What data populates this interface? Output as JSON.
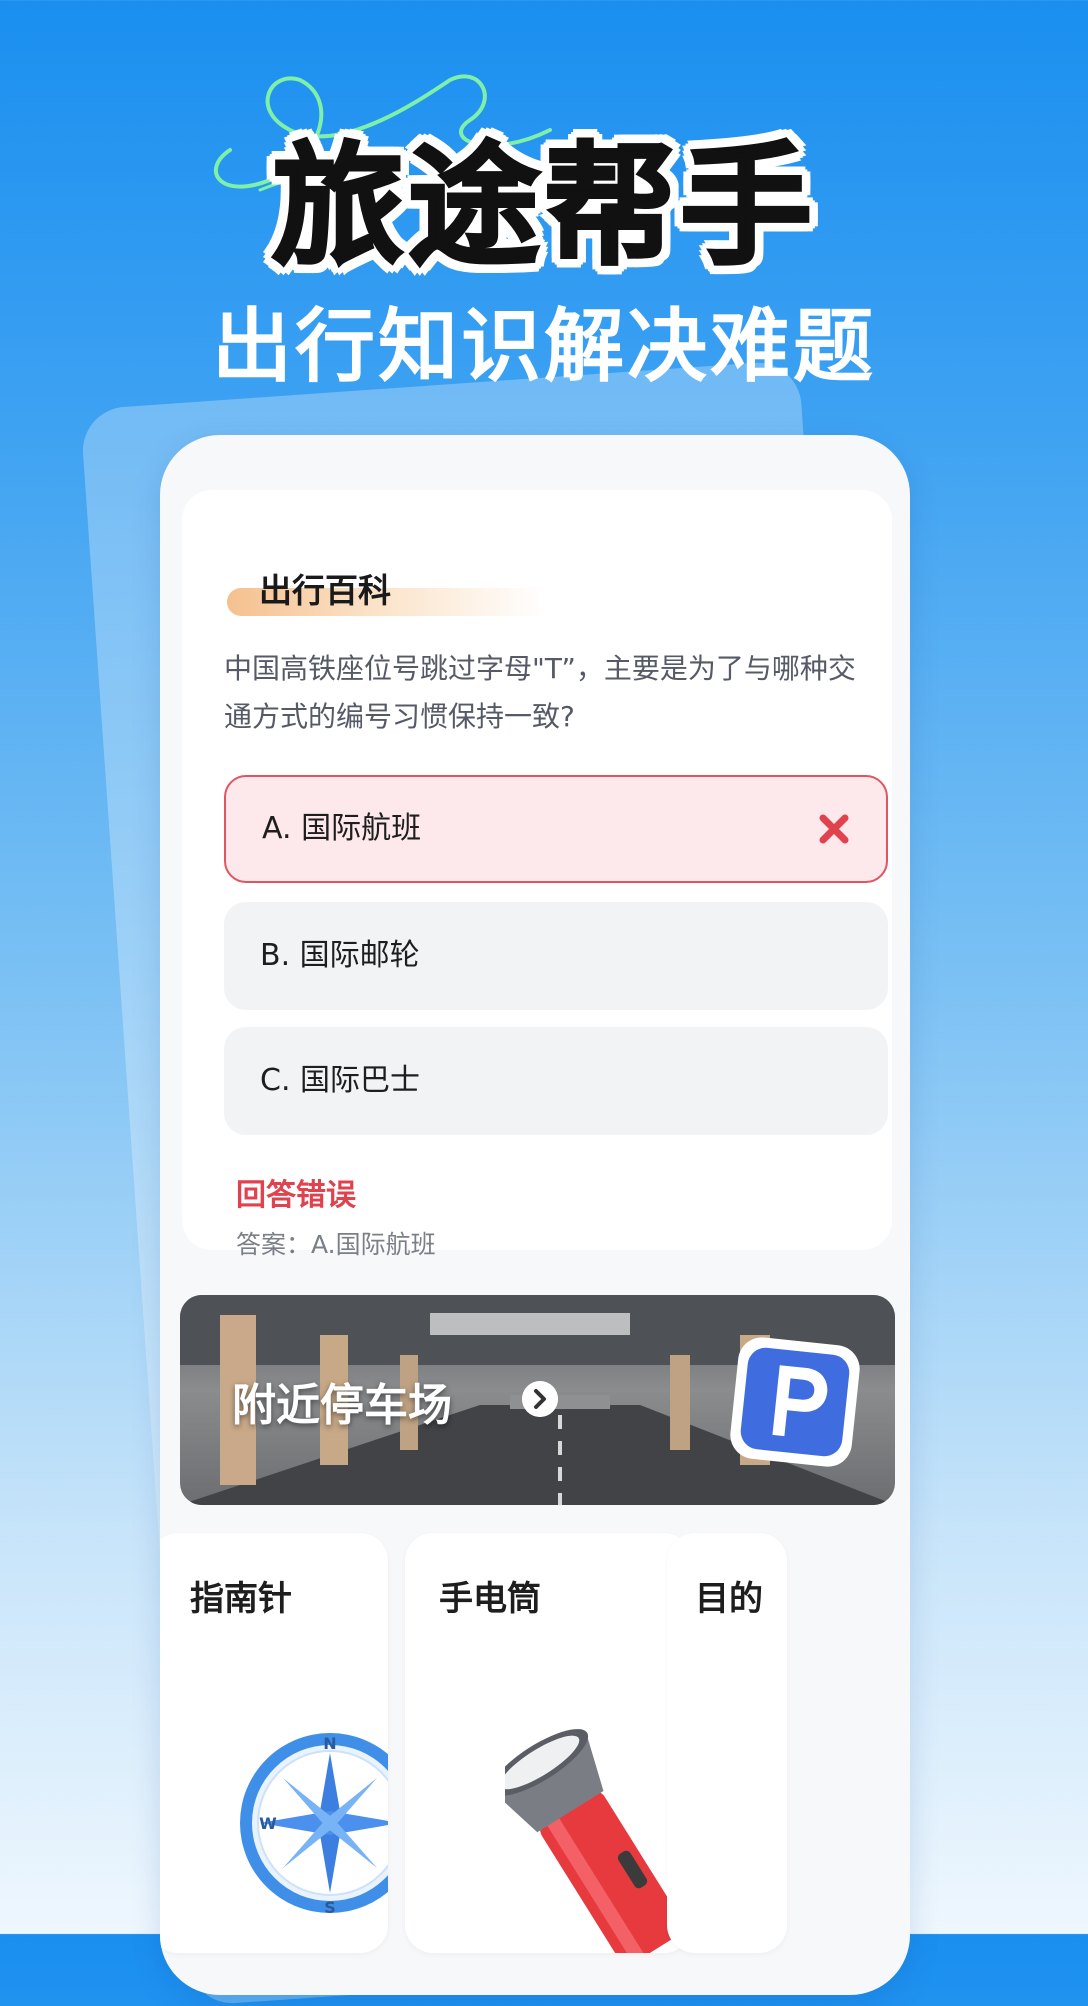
{
  "header": {
    "title": "旅途帮手",
    "subtitle": "出行知识解决难题"
  },
  "quiz": {
    "section_title": "出行百科",
    "question": "中国高铁座位号跳过字母\"T”，主要是为了与哪种交通方式的编号习惯保持一致?",
    "options": [
      {
        "label": "A. 国际航班",
        "state": "wrong"
      },
      {
        "label": "B. 国际邮轮",
        "state": "default"
      },
      {
        "label": "C. 国际巴士",
        "state": "default"
      }
    ],
    "result_text": "回答错误",
    "answer_text": "答案：A.国际航班"
  },
  "banner": {
    "label": "附近停车场"
  },
  "tools": [
    {
      "title": "指南针",
      "icon": "compass-icon"
    },
    {
      "title": "手电筒",
      "icon": "flashlight-icon"
    },
    {
      "title": "目的"
    }
  ],
  "colors": {
    "accent_red": "#e0424e",
    "wrong_bg": "#fde8eb",
    "option_bg": "#f2f3f5",
    "parking_blue": "#3f6de0"
  }
}
